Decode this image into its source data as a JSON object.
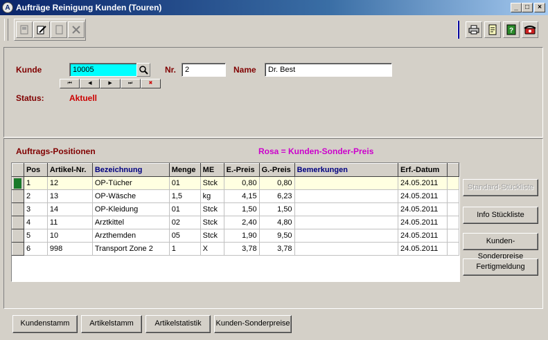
{
  "window": {
    "title": "Aufträge Reinigung Kunden (Touren)",
    "controls": {
      "minimize": "_",
      "maximize": "□",
      "close": "×"
    }
  },
  "toolbar": {
    "left_icons": [
      "new-icon",
      "edit-icon",
      "copy-icon",
      "delete-icon"
    ],
    "right_icons": [
      "print-icon",
      "document-icon",
      "help-icon",
      "phone-icon"
    ]
  },
  "header": {
    "kunde_label": "Kunde",
    "kunde_value": "10005",
    "nr_label": "Nr.",
    "nr_value": "2",
    "name_label": "Name",
    "name_value": "Dr. Best",
    "status_label": "Status:",
    "status_value": "Aktuell",
    "nav_buttons": [
      "⏮",
      "◀",
      "▶",
      "⏭",
      "✖"
    ]
  },
  "positions": {
    "title": "Auftrags-Positionen",
    "hint": "Rosa = Kunden-Sonder-Preis",
    "columns": [
      "Pos",
      "Artikel-Nr.",
      "Bezeichnung",
      "Menge",
      "ME",
      "E.-Preis",
      "G.-Preis",
      "Bemerkungen",
      "Erf.-Datum"
    ],
    "rows": [
      {
        "pos": "1",
        "artikel": "12",
        "bezeichnung": "OP-Tücher",
        "menge": "01",
        "me": "Stck",
        "epreis": "0,80",
        "gpreis": "0,80",
        "bemerkung": "",
        "datum": "24.05.2011"
      },
      {
        "pos": "2",
        "artikel": "13",
        "bezeichnung": "OP-Wäsche",
        "menge": "1,5",
        "me": "kg",
        "epreis": "4,15",
        "gpreis": "6,23",
        "bemerkung": "",
        "datum": "24.05.2011"
      },
      {
        "pos": "3",
        "artikel": "14",
        "bezeichnung": "OP-Kleidung",
        "menge": "01",
        "me": "Stck",
        "epreis": "1,50",
        "gpreis": "1,50",
        "bemerkung": "",
        "datum": "24.05.2011"
      },
      {
        "pos": "4",
        "artikel": "11",
        "bezeichnung": "Arztkittel",
        "menge": "02",
        "me": "Stck",
        "epreis": "2,40",
        "gpreis": "4,80",
        "bemerkung": "",
        "datum": "24.05.2011"
      },
      {
        "pos": "5",
        "artikel": "10",
        "bezeichnung": "Arzthemden",
        "menge": "05",
        "me": "Stck",
        "epreis": "1,90",
        "gpreis": "9,50",
        "bemerkung": "",
        "datum": "24.05.2011"
      },
      {
        "pos": "6",
        "artikel": "998",
        "bezeichnung": "Transport Zone 2",
        "menge": "1",
        "me": "X",
        "epreis": "3,78",
        "gpreis": "3,78",
        "bemerkung": "",
        "datum": "24.05.2011"
      }
    ]
  },
  "side_buttons": {
    "standard": "Standard-Stückliste",
    "info": "Info Stückliste",
    "sonderpreise": "Kunden-Sonderpreise",
    "fertig": "Fertigmeldung"
  },
  "bottom_buttons": {
    "kundenstamm": "Kundenstamm",
    "artikelstamm": "Artikelstamm",
    "artikelstatistik": "Artikelstatistik",
    "sonderpreise": "Kunden-Sonderpreise"
  },
  "colors": {
    "label": "#800000",
    "status": "#cc0000",
    "hint": "#cc00cc",
    "input_highlight": "#00ffff",
    "selected_row": "#ffffe1"
  }
}
